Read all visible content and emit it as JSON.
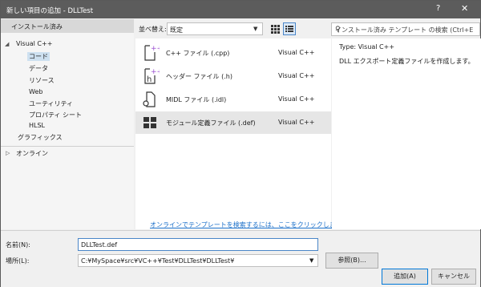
{
  "window": {
    "title": "新しい項目の追加 - DLLTest",
    "help": "?",
    "close": "✕"
  },
  "tree": {
    "header": "インストール済み",
    "root": "Visual C++",
    "children": [
      "コード",
      "データ",
      "リソース",
      "Web",
      "ユーティリティ",
      "プロパティ シート",
      "HLSL"
    ],
    "graphics": "グラフィックス",
    "online": "オンライン"
  },
  "toolbar": {
    "sort_label": "並べ替え:",
    "sort_value": "既定",
    "search_placeholder": "インストール済み テンプレート の検索 (Ctrl+E"
  },
  "templates": [
    {
      "name": "C++ ファイル (.cpp)",
      "type": "Visual C++"
    },
    {
      "name": "ヘッダー ファイル (.h)",
      "type": "Visual C++"
    },
    {
      "name": "MIDL ファイル (.idl)",
      "type": "Visual C++"
    },
    {
      "name": "モジュール定義ファイル (.def)",
      "type": "Visual C++"
    }
  ],
  "online_link": "オンラインでテンプレートを検索するには、ここをクリックします。",
  "details": {
    "type_label": "Type:",
    "type_value": "Visual C++",
    "description": "DLL エクスポート定義ファイルを作成します。"
  },
  "form": {
    "name_label": "名前(N):",
    "name_value": "DLLTest.def",
    "location_label": "場所(L):",
    "location_value": "C:¥MySpace¥src¥VC++¥Test¥DLLTest¥DLLTest¥",
    "browse": "参照(B)...",
    "add": "追加(A)",
    "cancel": "キャンセル"
  },
  "colors": {
    "titlebar": "#5c5c5c",
    "selection": "#cde0f0",
    "accent": "#0078d7",
    "link": "#1a6fc9",
    "icon_purple": "#9b4fd1"
  }
}
